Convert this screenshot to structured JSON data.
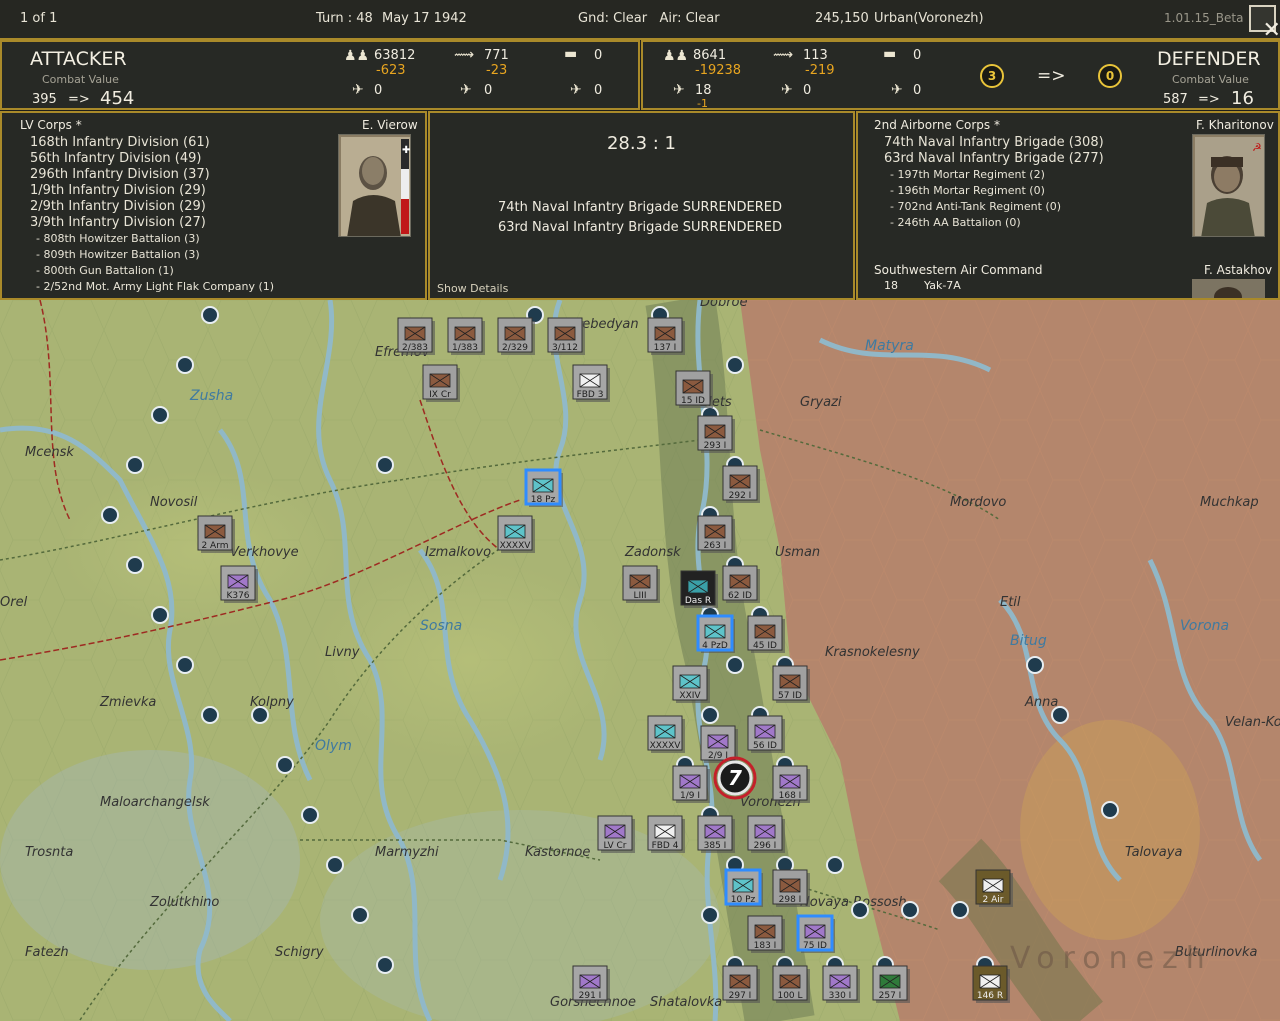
{
  "topbar": {
    "page": "1 of 1",
    "turn": "Turn : 48",
    "date": "May 17 1942",
    "weather": "Gnd: Clear   Air: Clear",
    "value": "245,150",
    "terrain": "Urban(Voronezh)",
    "version": "1.01.15_Beta"
  },
  "attacker": {
    "title": "ATTACKER",
    "combat_value_label": "Combat Value",
    "cv_before": "395",
    "arrow": "=>",
    "cv_after": "454",
    "men": "63812",
    "men_loss": "-623",
    "guns": "771",
    "guns_loss": "-23",
    "tanks": "0",
    "aircraft1": "0",
    "aircraft2": "0",
    "aircraft3": "0"
  },
  "defender": {
    "title": "DEFENDER",
    "combat_value_label": "Combat Value",
    "cv_before": "587",
    "arrow": "=>",
    "cv_after": "16",
    "men": "8641",
    "men_loss": "-19238",
    "guns": "113",
    "guns_loss": "-219",
    "tanks": "0",
    "aircraft1": "18",
    "aircraft1_loss": "-1",
    "aircraft2": "0",
    "aircraft3": "0"
  },
  "modifiers": {
    "left": "3",
    "arrow": "=>",
    "right": "0"
  },
  "attacker_units": {
    "corps": "LV Corps *",
    "leader": "E. Vierow",
    "list": [
      "168th Infantry Division (61)",
      "56th Infantry Division (49)",
      "296th Infantry Division (37)",
      "1/9th Infantry Division (29)",
      "2/9th Infantry Division (29)",
      "3/9th Infantry Division (27)"
    ],
    "sub": [
      "- 808th Howitzer Battalion (3)",
      "- 809th Howitzer Battalion (3)",
      "- 800th Gun Battalion (1)",
      "- 2/52nd Mot. Army Light Flak Company (1)"
    ]
  },
  "result": {
    "ratio": "28.3 : 1",
    "lines": [
      "74th Naval Infantry Brigade SURRENDERED",
      "63rd Naval Infantry Brigade SURRENDERED"
    ],
    "show_details": "Show Details"
  },
  "defender_units": {
    "corps": "2nd Airborne Corps *",
    "leader": "F. Kharitonov",
    "list": [
      "74th Naval Infantry Brigade (308)",
      "63rd Naval Infantry Brigade (277)"
    ],
    "sub": [
      "- 197th Mortar Regiment (2)",
      "- 196th Mortar Regiment (0)",
      "- 702nd Anti-Tank Regiment (0)",
      "- 246th AA Battalion (0)"
    ],
    "air_command": "Southwestern Air Command",
    "air_leader": "F. Astakhov",
    "air_count": "18",
    "air_type": "Yak-7A"
  },
  "map": {
    "places": [
      {
        "name": "Mcensk"
      },
      {
        "name": "Novosil"
      },
      {
        "name": "Verkhovye"
      },
      {
        "name": "Orel"
      },
      {
        "name": "Zmievka"
      },
      {
        "name": "Kolpny"
      },
      {
        "name": "Maloarchangelsk"
      },
      {
        "name": "Trosnta"
      },
      {
        "name": "Zolutkhino"
      },
      {
        "name": "Fatezh"
      },
      {
        "name": "Schigry"
      },
      {
        "name": "Marmyzhi"
      },
      {
        "name": "Kastornoe"
      },
      {
        "name": "Livny"
      },
      {
        "name": "Izmalkovo"
      },
      {
        "name": "Zadonsk"
      },
      {
        "name": "Usman"
      },
      {
        "name": "Gryazi"
      },
      {
        "name": "Mordovo"
      },
      {
        "name": "Muchkap"
      },
      {
        "name": "Krasnokelesny"
      },
      {
        "name": "Etil"
      },
      {
        "name": "Voronezh"
      },
      {
        "name": "Anna"
      },
      {
        "name": "Talovaya"
      },
      {
        "name": "Buturlinovka"
      },
      {
        "name": "Shatalovka"
      },
      {
        "name": "Gorshechnoe"
      },
      {
        "name": "Lebedyan"
      },
      {
        "name": "Efremov"
      },
      {
        "name": "Elets"
      },
      {
        "name": "Novaya Rossosh"
      },
      {
        "name": "Velan-Ko"
      },
      {
        "name": "Dobroe"
      },
      {
        "name": "Matyra"
      },
      {
        "name": "Zusha"
      },
      {
        "name": "Olym"
      },
      {
        "name": "Sosna"
      },
      {
        "name": "Bitug"
      },
      {
        "name": "Vorona"
      }
    ],
    "region_label": "Voronezh",
    "units": [
      {
        "id": "2/383",
        "type": "ger"
      },
      {
        "id": "1/383",
        "type": "ger"
      },
      {
        "id": "2/329",
        "type": "ger"
      },
      {
        "id": "3/112",
        "type": "ger"
      },
      {
        "id": "137 I",
        "type": "ger"
      },
      {
        "id": "IX Cr",
        "type": "ghq"
      },
      {
        "id": "FBD 3",
        "type": "white"
      },
      {
        "id": "15 ID",
        "type": "ger"
      },
      {
        "id": "293 I",
        "type": "ger"
      },
      {
        "id": "292 I",
        "type": "ger"
      },
      {
        "id": "18 Pz",
        "type": "pz"
      },
      {
        "id": "XXXXV",
        "type": "cyanhq"
      },
      {
        "id": "2 Arm",
        "type": "ghq"
      },
      {
        "id": "263 I",
        "type": "ger"
      },
      {
        "id": "LIII",
        "type": "ghq"
      },
      {
        "id": "Das R",
        "type": "ss"
      },
      {
        "id": "62 ID",
        "type": "ger"
      },
      {
        "id": "K376",
        "type": "purpsmall"
      },
      {
        "id": "4 PzD",
        "type": "pz"
      },
      {
        "id": "45 ID",
        "type": "ger"
      },
      {
        "id": "XXIV",
        "type": "cyanhq"
      },
      {
        "id": "57 ID",
        "type": "ger"
      },
      {
        "id": "XXXXV",
        "type": "cyanhq"
      },
      {
        "id": "2/9 I",
        "type": "hun"
      },
      {
        "id": "56 ID",
        "type": "hun"
      },
      {
        "id": "1/9 I",
        "type": "hun"
      },
      {
        "id": "168 I",
        "type": "hun"
      },
      {
        "id": "LV Cr",
        "type": "phq"
      },
      {
        "id": "FBD 4",
        "type": "white"
      },
      {
        "id": "385 I",
        "type": "hun"
      },
      {
        "id": "296 I",
        "type": "hun"
      },
      {
        "id": "10 Pz",
        "type": "pz"
      },
      {
        "id": "298 I",
        "type": "ger"
      },
      {
        "id": "183 I",
        "type": "ger"
      },
      {
        "id": "75 ID",
        "type": "hunsel"
      },
      {
        "id": "291 I",
        "type": "hun"
      },
      {
        "id": "297 I",
        "type": "ger"
      },
      {
        "id": "100 L",
        "type": "ger"
      },
      {
        "id": "330 I",
        "type": "hun"
      },
      {
        "id": "257 I",
        "type": "green"
      },
      {
        "id": "2 Air",
        "type": "sovhq"
      },
      {
        "id": "146 R",
        "type": "sov"
      }
    ],
    "battle_marker": "7"
  }
}
